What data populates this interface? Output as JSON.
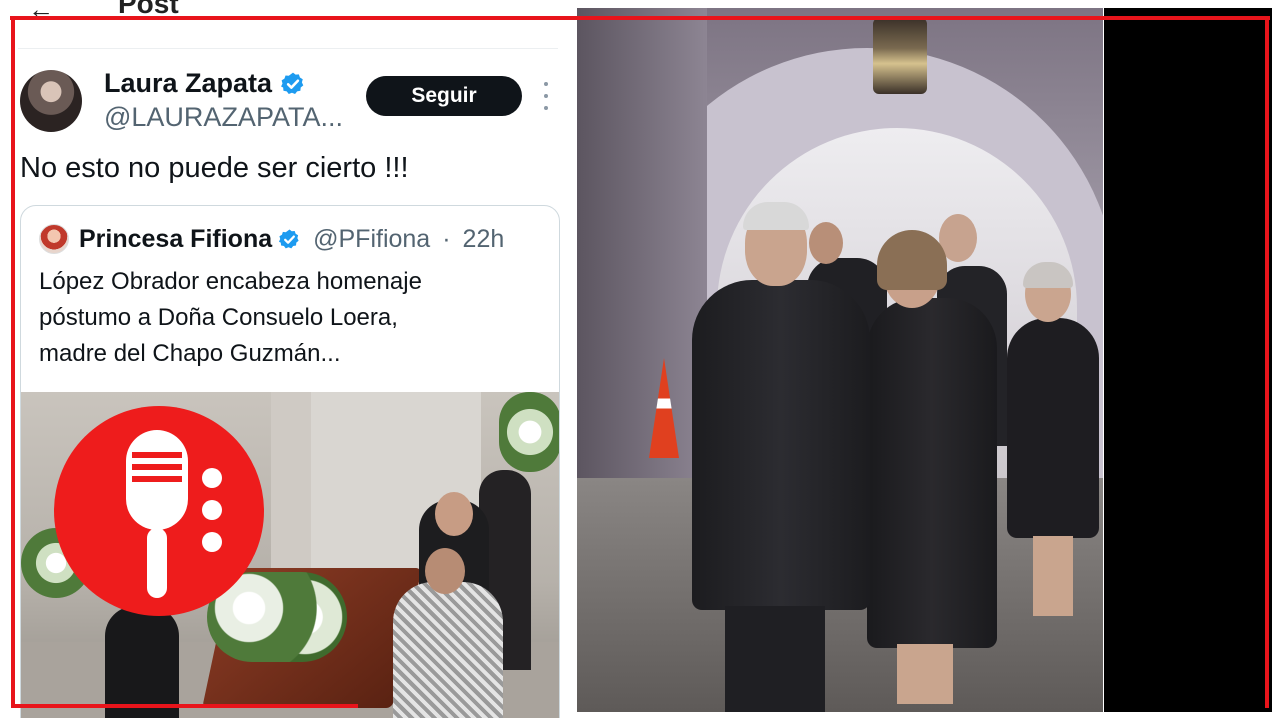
{
  "header": {
    "back_icon": "arrow-left-icon",
    "title": "Post"
  },
  "tweet": {
    "author_name": "Laura Zapata",
    "author_handle": "@LAURAZAPATA...",
    "verified_icon": "verified-badge-icon",
    "follow_label": "Seguir",
    "more_icon": "more-vertical-icon",
    "text": "No esto no puede ser cierto !!!"
  },
  "quote": {
    "author_name": "Princesa Fifiona",
    "author_handle": "@PFifiona",
    "separator": "·",
    "time": "22h",
    "lines": [
      "López Obrador encabeza homenaje",
      "póstumo a Doña Consuelo Loera,",
      "madre del Chapo Guzmán..."
    ]
  },
  "overlay": {
    "logo_icon": "microphone-logo-icon"
  },
  "colors": {
    "frame_red": "#e8141b",
    "verified_blue": "#1d9bf0",
    "follow_bg": "#0f1419",
    "logo_red": "#ee1c1c"
  }
}
